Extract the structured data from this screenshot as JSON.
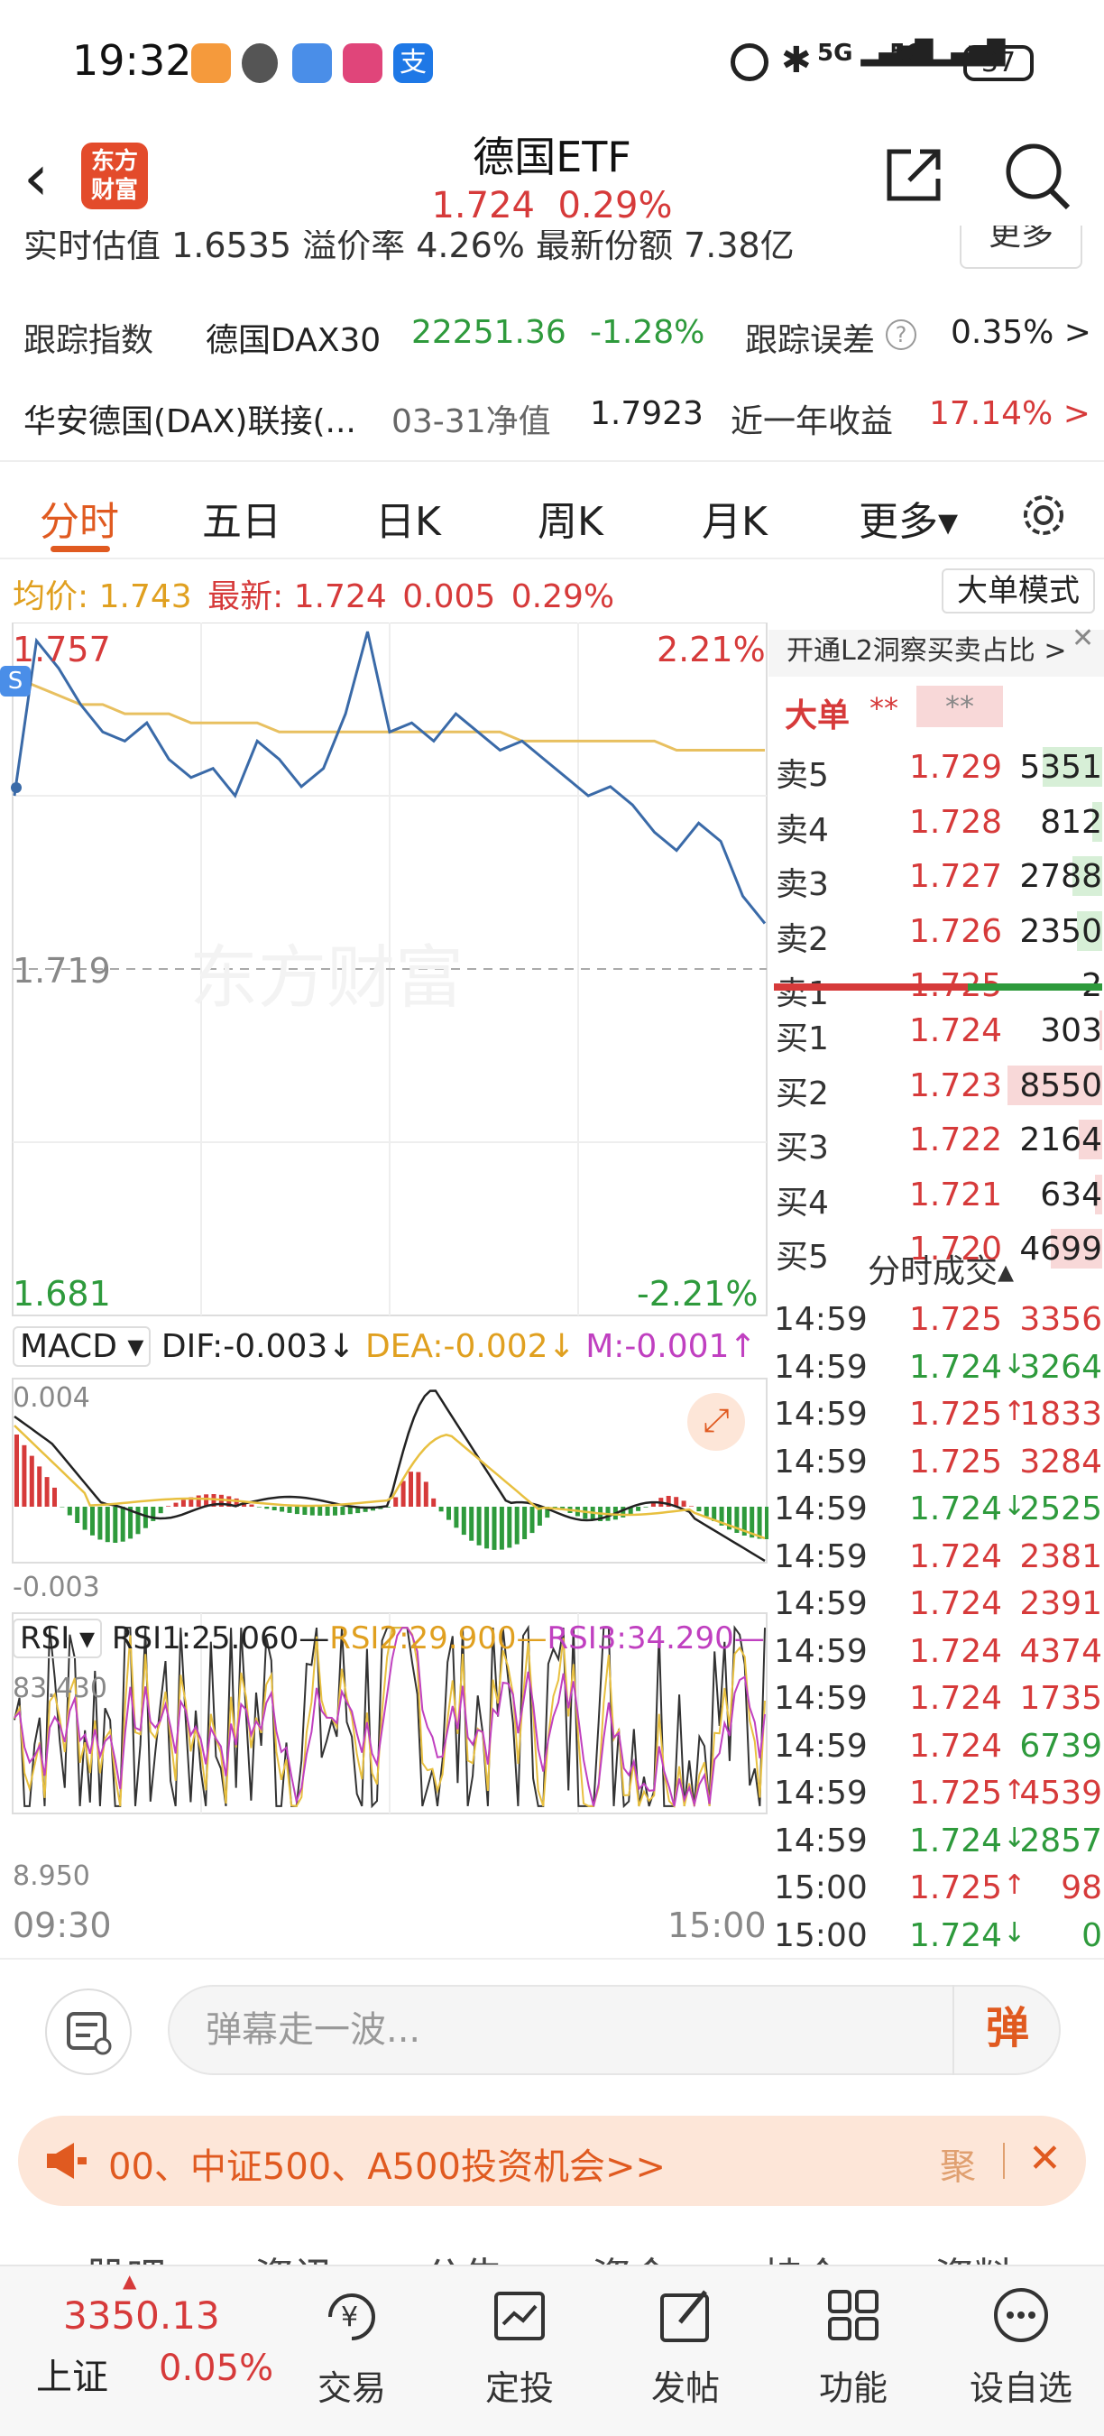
{
  "status": {
    "clock": "19:32",
    "network": "5G",
    "battery": "37"
  },
  "header": {
    "back_icon": "chevron-left-icon",
    "logo": "东方\n财富",
    "title": "德国ETF",
    "price": "1.724",
    "change_pct": "0.29%",
    "share_icon": "share-icon",
    "search_icon": "search-icon"
  },
  "info": {
    "row0_text": "实时估值  1.6535   溢价率  4.26%   最新份额  7.38亿",
    "more_label": "更多",
    "track_index_label": "跟踪指数",
    "track_index_name": "德国DAX30",
    "track_index_value": "22251.36",
    "track_index_change": "-1.28%",
    "track_error_label": "跟踪误差",
    "track_error_value": "0.35% >",
    "linked_fund_name": "华安德国(DAX)联接(...",
    "nav_date_label": "03-31净值",
    "nav_value": "1.7923",
    "year_return_label": "近一年收益",
    "year_return_value": "17.14% >"
  },
  "tabs": [
    {
      "label": "分时",
      "active": true
    },
    {
      "label": "五日"
    },
    {
      "label": "日K"
    },
    {
      "label": "周K"
    },
    {
      "label": "月K"
    },
    {
      "label": "更多▾"
    }
  ],
  "price_line": {
    "avg_label": "均价:",
    "avg_value": "1.743",
    "latest_label": "最新:",
    "latest_value": "1.724",
    "change": "0.005",
    "change_pct": "0.29%",
    "big_order_mode": "大单模式"
  },
  "chart": {
    "y_max": "1.757",
    "y_mid": "1.719",
    "y_min": "1.681",
    "pct_max": "2.21%",
    "pct_min": "-2.21%",
    "watermark": "东方财富",
    "macd_label": "MACD",
    "dif": "DIF:-0.003↓",
    "dea": "DEA:-0.002↓",
    "m": "M:-0.001↑",
    "macd_max": "0.004",
    "macd_min": "-0.003",
    "rsi_label": "RSI",
    "rsi1": "RSI1:25.060—",
    "rsi2": "RSI2:29.900—",
    "rsi3": "RSI3:34.290—",
    "rsi_max": "83.430",
    "rsi_min": "8.950",
    "time_start": "09:30",
    "time_end": "15:00"
  },
  "chart_data": {
    "type": "line",
    "title": "德国ETF",
    "x_range": [
      "09:30",
      "15:00"
    ],
    "ylim": [
      1.681,
      1.757
    ],
    "pre_close": 1.719,
    "series": [
      {
        "name": "最新",
        "values": [
          1.738,
          1.755,
          1.752,
          1.748,
          1.745,
          1.744,
          1.746,
          1.742,
          1.74,
          1.741,
          1.738,
          1.744,
          1.742,
          1.739,
          1.741,
          1.747,
          1.756,
          1.745,
          1.746,
          1.744,
          1.747,
          1.745,
          1.743,
          1.744,
          1.742,
          1.74,
          1.738,
          1.739,
          1.737,
          1.734,
          1.732,
          1.735,
          1.733,
          1.727,
          1.724
        ]
      },
      {
        "name": "均价",
        "values": [
          1.751,
          1.75,
          1.749,
          1.748,
          1.748,
          1.747,
          1.747,
          1.747,
          1.746,
          1.746,
          1.746,
          1.746,
          1.745,
          1.745,
          1.745,
          1.745,
          1.745,
          1.745,
          1.745,
          1.745,
          1.745,
          1.745,
          1.745,
          1.744,
          1.744,
          1.744,
          1.744,
          1.744,
          1.744,
          1.744,
          1.743,
          1.743,
          1.743,
          1.743,
          1.743
        ]
      }
    ],
    "macd": {
      "ylim": [
        -0.003,
        0.004
      ]
    },
    "rsi": {
      "ylim": [
        8.95,
        83.43
      ]
    }
  },
  "orderbook": {
    "promo": "开通L2洞察买卖占比 >",
    "big_order_label": "大单",
    "big_order_value1": "**",
    "big_order_value2": "**",
    "asks": [
      {
        "name": "卖5",
        "price": "1.729",
        "vol": "5351",
        "bar": 0.6
      },
      {
        "name": "卖4",
        "price": "1.728",
        "vol": "812",
        "bar": 0.1
      },
      {
        "name": "卖3",
        "price": "1.727",
        "vol": "2788",
        "bar": 0.3
      },
      {
        "name": "卖2",
        "price": "1.726",
        "vol": "2350",
        "bar": 0.25
      },
      {
        "name": "卖1",
        "price": "1.725",
        "vol": "2",
        "bar": 0.0
      }
    ],
    "bids": [
      {
        "name": "买1",
        "price": "1.724",
        "vol": "303",
        "bar": 0.03
      },
      {
        "name": "买2",
        "price": "1.723",
        "vol": "8550",
        "bar": 0.95
      },
      {
        "name": "买3",
        "price": "1.722",
        "vol": "2164",
        "bar": 0.24
      },
      {
        "name": "买4",
        "price": "1.721",
        "vol": "634",
        "bar": 0.07
      },
      {
        "name": "买5",
        "price": "1.720",
        "vol": "4699",
        "bar": 0.52
      }
    ],
    "trades_title": "分时成交▴",
    "trades": [
      {
        "time": "14:59",
        "price": "1.725",
        "arrow": "",
        "vol": "3356",
        "color": "red"
      },
      {
        "time": "14:59",
        "price": "1.724",
        "arrow": "↓",
        "vol": "3264",
        "color": "green"
      },
      {
        "time": "14:59",
        "price": "1.725",
        "arrow": "↑",
        "vol": "1833",
        "color": "red"
      },
      {
        "time": "14:59",
        "price": "1.725",
        "arrow": "",
        "vol": "3284",
        "color": "red"
      },
      {
        "time": "14:59",
        "price": "1.724",
        "arrow": "↓",
        "vol": "2525",
        "color": "green"
      },
      {
        "time": "14:59",
        "price": "1.724",
        "arrow": "",
        "vol": "2381",
        "color": "red"
      },
      {
        "time": "14:59",
        "price": "1.724",
        "arrow": "",
        "vol": "2391",
        "color": "red"
      },
      {
        "time": "14:59",
        "price": "1.724",
        "arrow": "",
        "vol": "4374",
        "color": "red"
      },
      {
        "time": "14:59",
        "price": "1.724",
        "arrow": "",
        "vol": "1735",
        "color": "red"
      },
      {
        "time": "14:59",
        "price": "1.724",
        "arrow": "",
        "vol": "6739",
        "color": "green"
      },
      {
        "time": "14:59",
        "price": "1.725",
        "arrow": "↑",
        "vol": "4539",
        "color": "red"
      },
      {
        "time": "14:59",
        "price": "1.724",
        "arrow": "↓",
        "vol": "2857",
        "color": "green"
      },
      {
        "time": "15:00",
        "price": "1.725",
        "arrow": "↑",
        "vol": "98",
        "color": "red"
      },
      {
        "time": "15:00",
        "price": "1.724",
        "arrow": "↓",
        "vol": "0",
        "color": "green"
      }
    ]
  },
  "danmu": {
    "placeholder": "弹幕走一波...",
    "send_label": "弹"
  },
  "banner": {
    "text": "00、中证500、A500投资机会>>",
    "ju": "聚",
    "close": "✕"
  },
  "subtabs": [
    "股吧",
    "资讯",
    "公告",
    "资金",
    "持仓",
    "资料"
  ],
  "bottom": {
    "index_value": "3350.13",
    "index_name": "上证",
    "index_change": "0.05%",
    "nav": [
      {
        "label": "交易",
        "icon": "yen-circle-icon"
      },
      {
        "label": "定投",
        "icon": "chart-calendar-icon"
      },
      {
        "label": "发帖",
        "icon": "edit-icon"
      },
      {
        "label": "功能",
        "icon": "grid-icon"
      },
      {
        "label": "设自选",
        "icon": "more-circle-icon"
      }
    ]
  },
  "colors": {
    "up": "#d63a3a",
    "down": "#2e9a3c",
    "accent": "#e05a20",
    "price_line": "#3a6aa8",
    "avg_line": "#e8c060"
  }
}
